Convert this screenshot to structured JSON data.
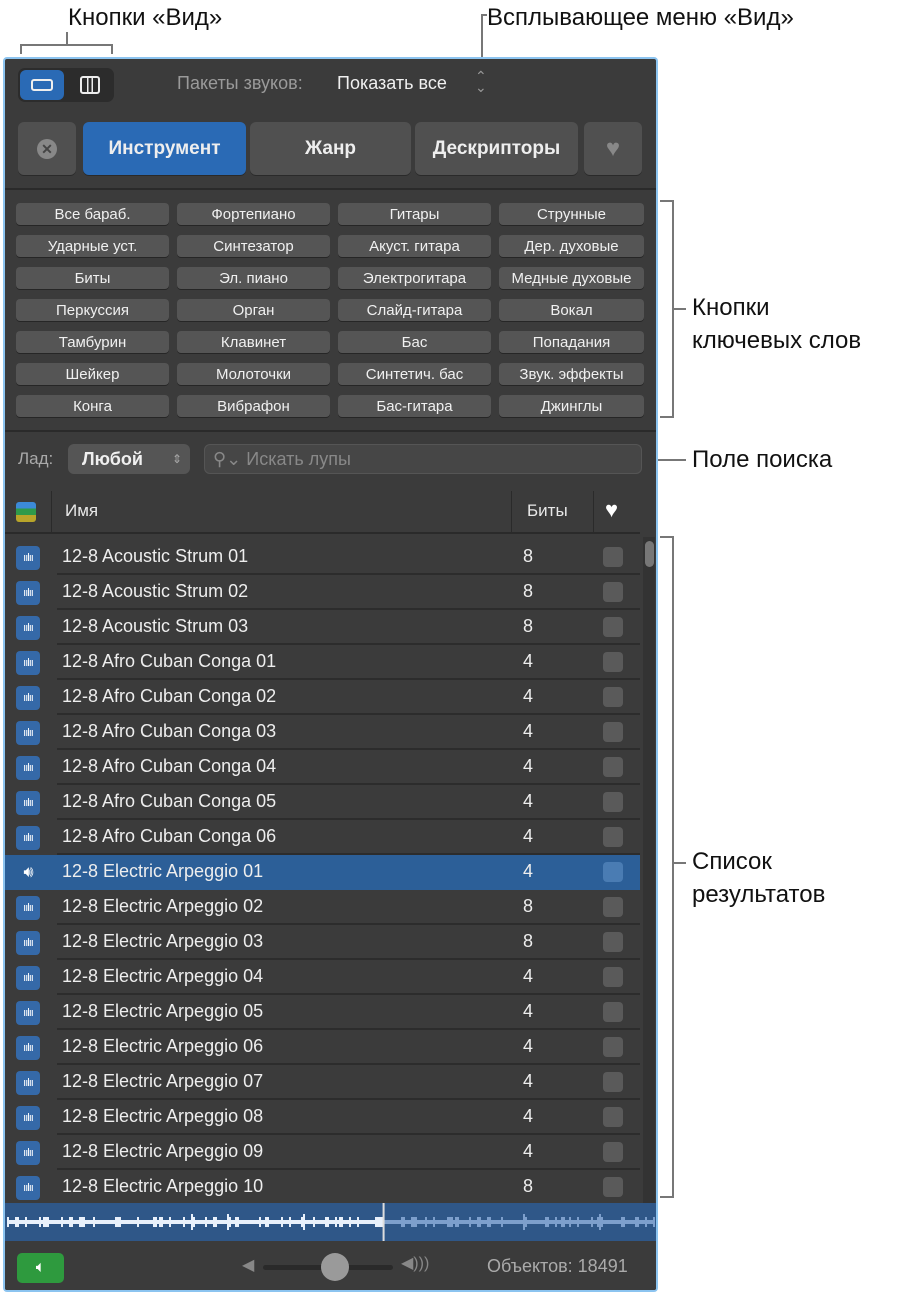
{
  "callouts": {
    "view_buttons": "Кнопки «Вид»",
    "view_menu": "Всплывающее меню «Вид»",
    "keyword_buttons": [
      "Кнопки",
      "ключевых слов"
    ],
    "search_field": "Поле поиска",
    "results_list": [
      "Список",
      "результатов"
    ]
  },
  "topbar": {
    "packs_label": "Пакеты звуков:",
    "packs_value": "Показать все"
  },
  "tabs": [
    "Инструмент",
    "Жанр",
    "Дескрипторы"
  ],
  "keywords": [
    [
      "Все бараб.",
      "Фортепиано",
      "Гитары",
      "Струнные"
    ],
    [
      "Ударные уст.",
      "Синтезатор",
      "Акуст. гитара",
      "Дер. духовые"
    ],
    [
      "Биты",
      "Эл. пиано",
      "Электрогитара",
      "Медные духовые"
    ],
    [
      "Перкуссия",
      "Орган",
      "Слайд-гитара",
      "Вокал"
    ],
    [
      "Тамбурин",
      "Клавинет",
      "Бас",
      "Попадания"
    ],
    [
      "Шейкер",
      "Молоточки",
      "Синтетич. бас",
      "Звук. эффекты"
    ],
    [
      "Конга",
      "Вибрафон",
      "Бас-гитара",
      "Джинглы"
    ]
  ],
  "filter": {
    "key_label": "Лад:",
    "key_value": "Любой",
    "search_placeholder": "Искать лупы"
  },
  "table": {
    "col_name": "Имя",
    "col_beats": "Биты",
    "rows": [
      {
        "name": "12-8 Acoustic Strum 01",
        "beats": "8"
      },
      {
        "name": "12-8 Acoustic Strum 02",
        "beats": "8"
      },
      {
        "name": "12-8 Acoustic Strum 03",
        "beats": "8"
      },
      {
        "name": "12-8 Afro Cuban Conga 01",
        "beats": "4"
      },
      {
        "name": "12-8 Afro Cuban Conga 02",
        "beats": "4"
      },
      {
        "name": "12-8 Afro Cuban Conga 03",
        "beats": "4"
      },
      {
        "name": "12-8 Afro Cuban Conga 04",
        "beats": "4"
      },
      {
        "name": "12-8 Afro Cuban Conga 05",
        "beats": "4"
      },
      {
        "name": "12-8 Afro Cuban Conga 06",
        "beats": "4"
      },
      {
        "name": "12-8 Electric Arpeggio 01",
        "beats": "4",
        "selected": true
      },
      {
        "name": "12-8 Electric Arpeggio 02",
        "beats": "8"
      },
      {
        "name": "12-8 Electric Arpeggio 03",
        "beats": "8"
      },
      {
        "name": "12-8 Electric Arpeggio 04",
        "beats": "4"
      },
      {
        "name": "12-8 Electric Arpeggio 05",
        "beats": "4"
      },
      {
        "name": "12-8 Electric Arpeggio 06",
        "beats": "4"
      },
      {
        "name": "12-8 Electric Arpeggio 07",
        "beats": "4"
      },
      {
        "name": "12-8 Electric Arpeggio 08",
        "beats": "4"
      },
      {
        "name": "12-8 Electric Arpeggio 09",
        "beats": "4"
      },
      {
        "name": "12-8 Electric Arpeggio 10",
        "beats": "8"
      }
    ]
  },
  "footer": {
    "count": "Объектов: 18491",
    "volume": 0.55,
    "playhead": 0.58
  }
}
